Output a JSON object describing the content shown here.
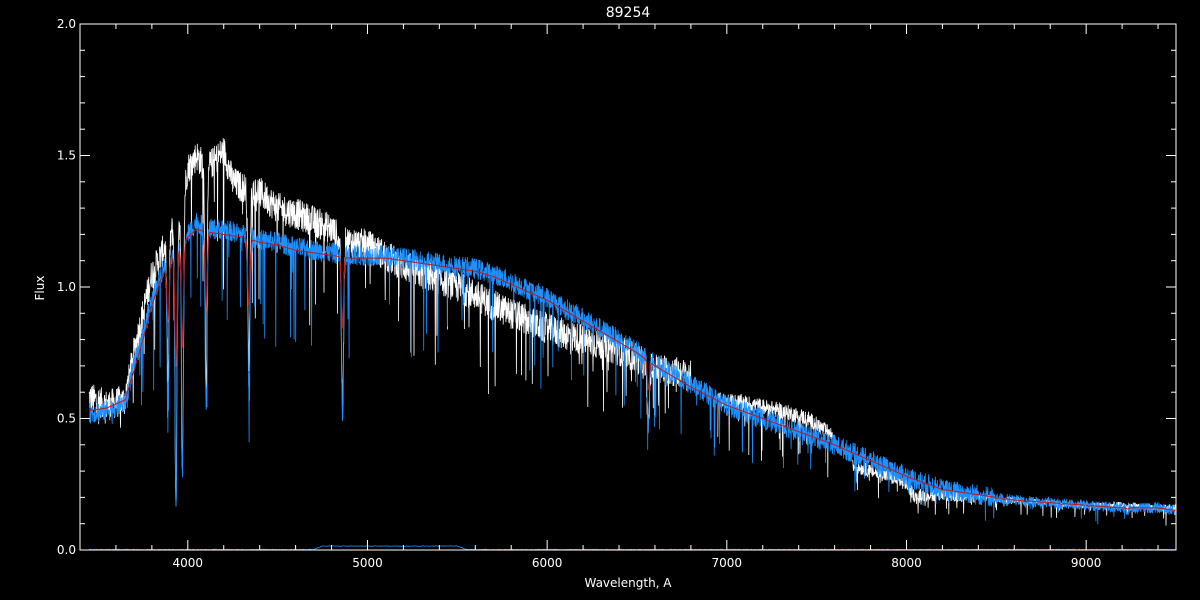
{
  "chart_data": {
    "type": "line",
    "title": "89254",
    "xlabel": "Wavelength, A",
    "ylabel": "Flux",
    "xlim": [
      3400,
      9500
    ],
    "ylim": [
      0,
      2.0
    ],
    "x_ticks": [
      4000,
      5000,
      6000,
      7000,
      8000,
      9000
    ],
    "y_ticks": [
      0.0,
      0.5,
      1.0,
      1.5,
      2.0
    ],
    "y_tick_labels": [
      "0.0",
      "0.5",
      "1.0",
      "1.5",
      "2.0"
    ],
    "grid": false,
    "legend": "none",
    "colors": {
      "background": "#000000",
      "axes": "#ffffff",
      "observed": "#ffffff",
      "model": "#1e90ff",
      "smooth": "#c01818",
      "error": "#1e90ff"
    },
    "series": [
      {
        "id": "observed",
        "noise": 0.06,
        "x": [
          3450,
          3550,
          3650,
          3700,
          3750,
          3800,
          3850,
          3900,
          3950,
          4000,
          4050,
          4100,
          4150,
          4200,
          4250,
          4300,
          4400,
          4500,
          4600,
          4700,
          4800,
          4850,
          4900,
          5000,
          5100,
          5200,
          5300,
          5400,
          5500,
          5600,
          5700,
          5800,
          5900,
          6000,
          6100,
          6200,
          6300,
          6400,
          6500,
          6550,
          6600,
          6700,
          6800
        ],
        "y": [
          0.58,
          0.55,
          0.57,
          0.75,
          0.9,
          1.05,
          1.12,
          1.2,
          1.25,
          1.45,
          1.5,
          1.45,
          1.48,
          1.52,
          1.4,
          1.38,
          1.36,
          1.3,
          1.28,
          1.25,
          1.22,
          1.18,
          1.17,
          1.16,
          1.12,
          1.08,
          1.05,
          1.03,
          1.0,
          0.97,
          0.93,
          0.9,
          0.87,
          0.84,
          0.82,
          0.8,
          0.78,
          0.76,
          0.73,
          0.7,
          0.69,
          0.68,
          0.66
        ]
      },
      {
        "id": "observed-red",
        "noise": 0.03,
        "x": [
          6950,
          7100,
          7300,
          7450,
          7600
        ],
        "y": [
          0.57,
          0.56,
          0.53,
          0.5,
          0.43
        ]
      },
      {
        "id": "observed-far-red",
        "noise": 0.025,
        "x": [
          7700,
          7800,
          7900,
          8000,
          8050,
          8100,
          8200,
          8400,
          8600,
          8800,
          9000,
          9200,
          9400,
          9500
        ],
        "y": [
          0.32,
          0.3,
          0.28,
          0.25,
          0.2,
          0.21,
          0.21,
          0.2,
          0.19,
          0.18,
          0.17,
          0.17,
          0.16,
          0.16
        ]
      },
      {
        "id": "model",
        "noise": 0.04,
        "x": [
          3450,
          3550,
          3650,
          3700,
          3750,
          3800,
          3850,
          3900,
          3950,
          4000,
          4050,
          4100,
          4200,
          4300,
          4400,
          4500,
          4600,
          4700,
          4800,
          4900,
          5000,
          5100,
          5200,
          5300,
          5400,
          5500,
          5600,
          5700,
          5800,
          5900,
          6000,
          6100,
          6200,
          6300,
          6400,
          6500,
          6600,
          6700,
          6800,
          7000,
          7200,
          7400,
          7600,
          7800,
          8000,
          8200,
          8400,
          8600,
          8800,
          9000,
          9200,
          9400,
          9500
        ],
        "y": [
          0.52,
          0.53,
          0.56,
          0.7,
          0.82,
          0.95,
          1.05,
          1.12,
          1.15,
          1.2,
          1.25,
          1.22,
          1.22,
          1.2,
          1.18,
          1.17,
          1.15,
          1.14,
          1.13,
          1.12,
          1.12,
          1.12,
          1.11,
          1.1,
          1.09,
          1.08,
          1.07,
          1.05,
          1.02,
          0.99,
          0.96,
          0.92,
          0.88,
          0.84,
          0.8,
          0.76,
          0.71,
          0.67,
          0.63,
          0.55,
          0.5,
          0.45,
          0.4,
          0.34,
          0.28,
          0.23,
          0.21,
          0.19,
          0.18,
          0.17,
          0.16,
          0.16,
          0.15
        ]
      },
      {
        "id": "smooth",
        "noise": 0,
        "x": [
          3450,
          3550,
          3650,
          3700,
          3750,
          3800,
          3850,
          3900,
          3950,
          4000,
          4050,
          4100,
          4200,
          4300,
          4400,
          4500,
          4600,
          4700,
          4800,
          4900,
          5000,
          5100,
          5200,
          5300,
          5400,
          5500,
          5600,
          5700,
          5800,
          5900,
          6000,
          6100,
          6200,
          6300,
          6400,
          6500,
          6600,
          6700,
          6800,
          7000,
          7200,
          7400,
          7600,
          7800,
          8000,
          8200,
          8400,
          8600,
          8800,
          9000,
          9200,
          9400,
          9500
        ],
        "y": [
          0.53,
          0.54,
          0.57,
          0.68,
          0.8,
          0.93,
          1.03,
          1.1,
          1.14,
          1.19,
          1.22,
          1.21,
          1.2,
          1.19,
          1.17,
          1.16,
          1.14,
          1.13,
          1.12,
          1.11,
          1.11,
          1.11,
          1.1,
          1.09,
          1.08,
          1.07,
          1.06,
          1.04,
          1.01,
          0.98,
          0.95,
          0.91,
          0.87,
          0.83,
          0.79,
          0.75,
          0.7,
          0.66,
          0.62,
          0.55,
          0.5,
          0.45,
          0.4,
          0.34,
          0.28,
          0.23,
          0.21,
          0.19,
          0.18,
          0.17,
          0.16,
          0.16,
          0.15
        ]
      },
      {
        "id": "error",
        "noise": 0.002,
        "x": [
          3450,
          4700,
          4750,
          5500,
          5550,
          9500
        ],
        "y": [
          0.002,
          0.002,
          0.015,
          0.015,
          0.002,
          0.002
        ]
      }
    ],
    "absorption_lines": [
      {
        "x": 3890,
        "depth": 0.45
      },
      {
        "x": 3934,
        "depth": 0.85
      },
      {
        "x": 3970,
        "depth": 0.75
      },
      {
        "x": 4102,
        "depth": 0.55
      },
      {
        "x": 4340,
        "depth": 0.5
      },
      {
        "x": 4861,
        "depth": 0.55
      },
      {
        "x": 6563,
        "depth": 0.35
      },
      {
        "x": 8498,
        "depth": 0.06
      },
      {
        "x": 8542,
        "depth": 0.07
      },
      {
        "x": 8662,
        "depth": 0.06
      },
      {
        "x": 8750,
        "depth": 0.04
      },
      {
        "x": 8862,
        "depth": 0.05
      },
      {
        "x": 9015,
        "depth": 0.05
      },
      {
        "x": 9229,
        "depth": 0.06
      }
    ]
  }
}
